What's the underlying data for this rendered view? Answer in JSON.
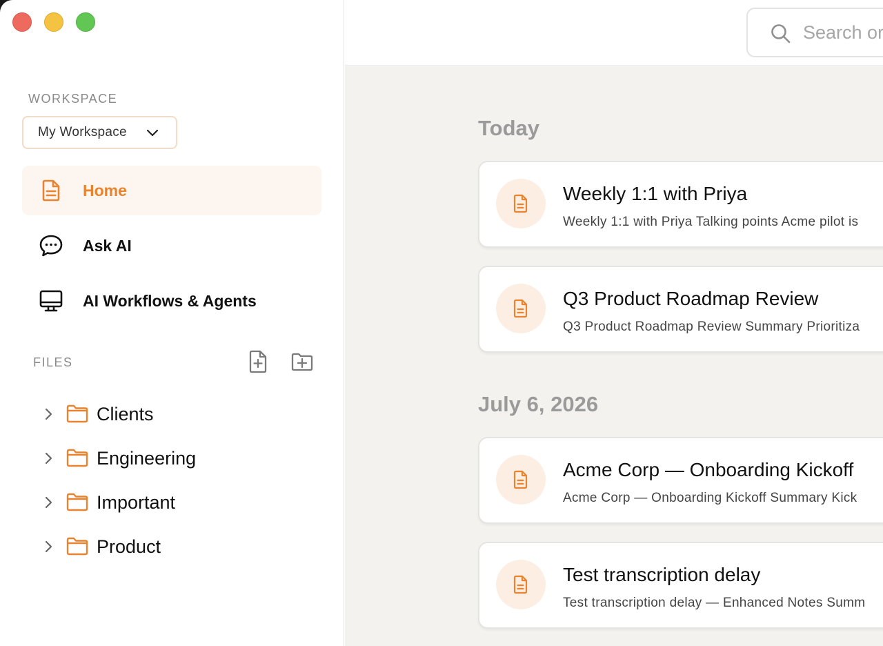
{
  "window": {
    "controls": [
      "close",
      "minimize",
      "zoom"
    ]
  },
  "sidebar": {
    "workspace_label": "WORKSPACE",
    "workspace_selected": "My Workspace",
    "nav": [
      {
        "label": "Home",
        "icon": "document-icon",
        "active": true
      },
      {
        "label": "Ask AI",
        "icon": "chat-bubble-icon",
        "active": false
      },
      {
        "label": "AI Workflows & Agents",
        "icon": "monitor-icon",
        "active": false
      }
    ],
    "files_label": "FILES",
    "folders": [
      {
        "name": "Clients"
      },
      {
        "name": "Engineering"
      },
      {
        "name": "Important"
      },
      {
        "name": "Product"
      }
    ]
  },
  "search": {
    "placeholder": "Search or"
  },
  "feed": {
    "groups": [
      {
        "date": "Today",
        "notes": [
          {
            "title": "Weekly 1:1 with Priya",
            "snippet": "Weekly 1:1 with Priya Talking points Acme pilot is"
          },
          {
            "title": "Q3 Product Roadmap Review",
            "snippet": "Q3 Product Roadmap Review Summary Prioritiza"
          }
        ]
      },
      {
        "date": "July 6, 2026",
        "notes": [
          {
            "title": "Acme Corp — Onboarding Kickoff",
            "snippet": "Acme Corp — Onboarding Kickoff Summary Kick"
          },
          {
            "title": "Test transcription delay",
            "snippet": "Test transcription delay — Enhanced Notes Summ"
          }
        ]
      }
    ]
  },
  "colors": {
    "accent": "#e8832f",
    "accent_soft": "#fdf5ef",
    "main_bg": "#f3f2ee",
    "muted_text": "#9a9a9a"
  }
}
